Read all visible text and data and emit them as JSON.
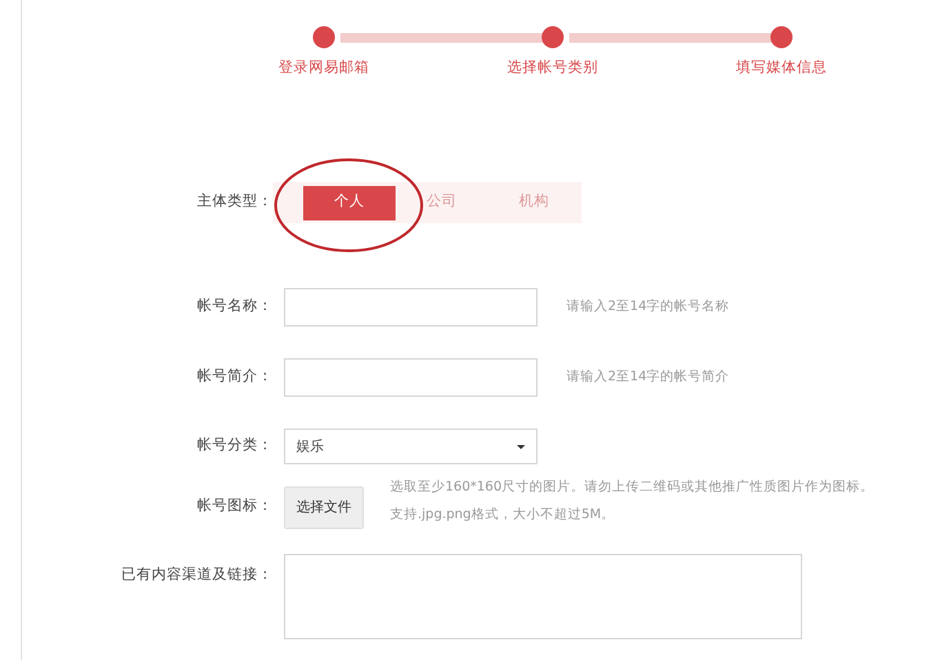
{
  "steps": [
    {
      "label": "登录网易邮箱"
    },
    {
      "label": "选择帐号类别"
    },
    {
      "label": "填写媒体信息"
    }
  ],
  "subject_type": {
    "label": "主体类型：",
    "options": [
      {
        "label": "个人",
        "selected": true
      },
      {
        "label": "公司",
        "selected": false
      },
      {
        "label": "机构",
        "selected": false
      }
    ]
  },
  "fields": [
    {
      "kind": "text",
      "label": "帐号名称：",
      "hint": "请输入2至14字的帐号名称"
    },
    {
      "kind": "text",
      "label": "帐号简介：",
      "hint": "请输入2至14字的帐号简介"
    },
    {
      "kind": "select",
      "label": "帐号分类：",
      "value": "娱乐"
    },
    {
      "kind": "file",
      "label": "帐号图标：",
      "button": "选择文件",
      "hint_lines": [
        "选取至少160*160尺寸的图片。请勿上传二维码或其他推广性质图片作为图标。",
        "支持.jpg.png格式，大小不超过5M。"
      ]
    },
    {
      "kind": "textarea",
      "label": "已有内容渠道及链接："
    }
  ]
}
